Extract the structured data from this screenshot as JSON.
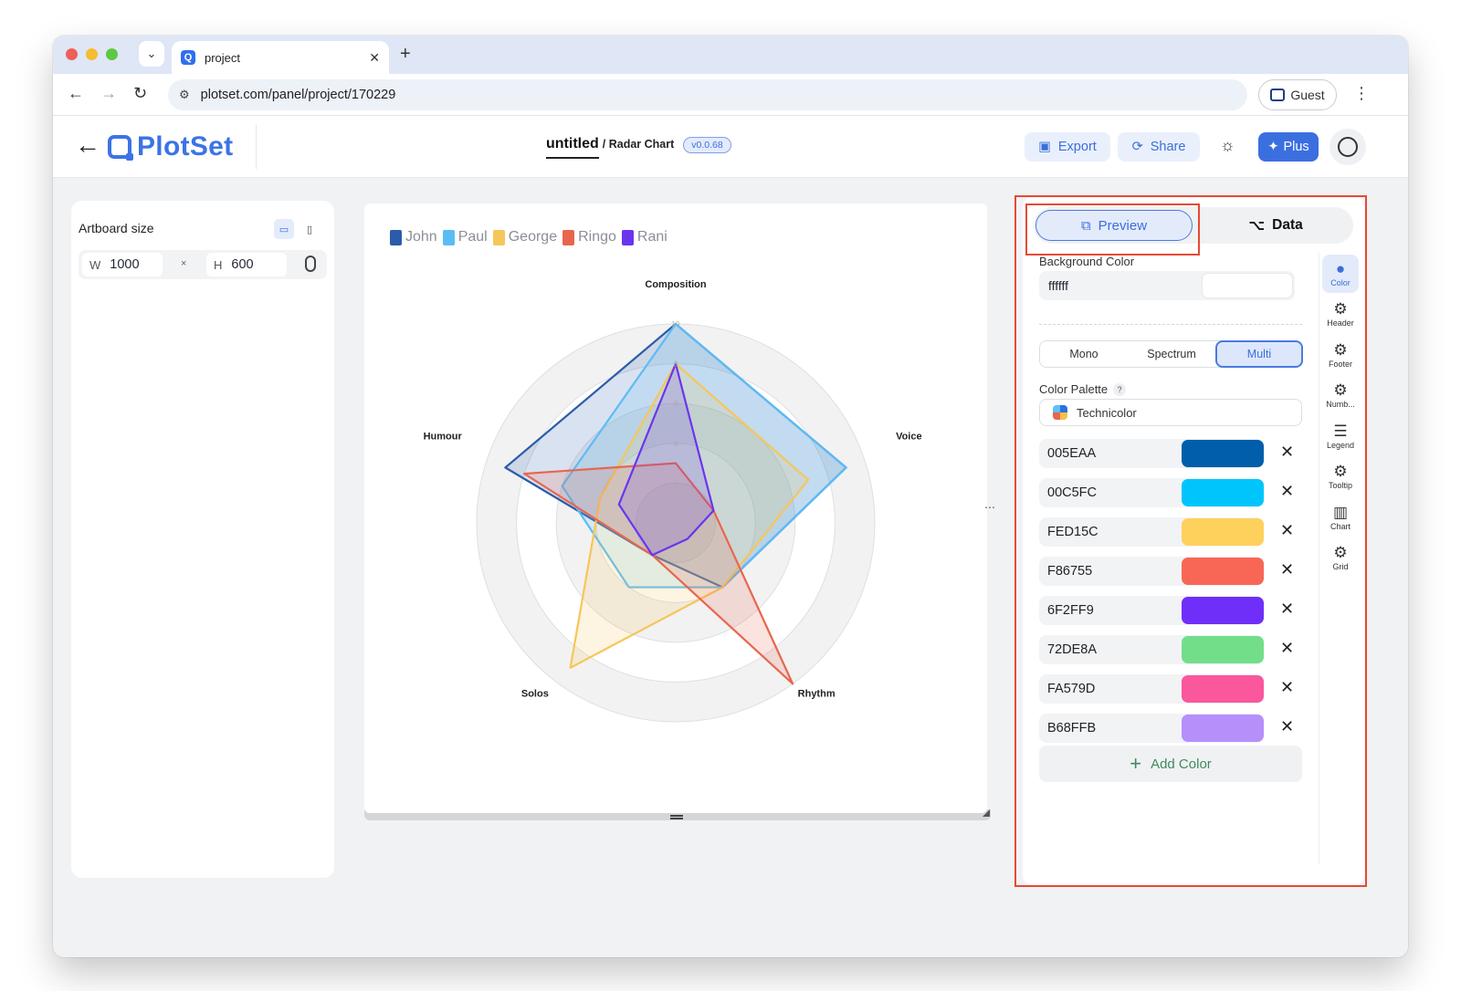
{
  "browser": {
    "tab_title": "project",
    "url": "plotset.com/panel/project/170229",
    "guest_label": "Guest"
  },
  "app": {
    "logo_text": "PlotSet",
    "doc_title": "untitled",
    "doc_type": "/ Radar Chart",
    "version": "v0.0.68",
    "export_label": "Export",
    "share_label": "Share",
    "plus_label": "Plus"
  },
  "artboard": {
    "label": "Artboard size",
    "width_prefix": "W",
    "width": "1000",
    "separator": "×",
    "height_prefix": "H",
    "height": "600"
  },
  "panel": {
    "tab_preview": "Preview",
    "tab_data": "Data",
    "background_label": "Background Color",
    "background_value": "ffffff",
    "modes": [
      "Mono",
      "Spectrum",
      "Multi"
    ],
    "active_mode": "Multi",
    "palette_label": "Color Palette",
    "palette_help": "?",
    "palette_name": "Technicolor",
    "colors": [
      "005EAA",
      "00C5FC",
      "FED15C",
      "F86755",
      "6F2FF9",
      "72DE8A",
      "FA579D",
      "B68FFB"
    ],
    "add_color_label": "Add Color",
    "side_nav": [
      "Color",
      "Header",
      "Footer",
      "Numb...",
      "Legend",
      "Tooltip",
      "Chart",
      "Grid"
    ]
  },
  "chart_data": {
    "type": "radar",
    "axes": [
      "Composition",
      "Voice",
      "Rhythm",
      "Solos",
      "Humour"
    ],
    "rmax": 10,
    "ticks": [
      "2",
      "4",
      "6",
      "8",
      "10"
    ],
    "series": [
      {
        "name": "John",
        "color": "#2a5caa",
        "values": [
          10,
          9,
          4,
          2,
          9
        ]
      },
      {
        "name": "Paul",
        "color": "#5bbcf5",
        "values": [
          10,
          9,
          4,
          4,
          6
        ]
      },
      {
        "name": "George",
        "color": "#f6c65b",
        "values": [
          8,
          7,
          4,
          9,
          4
        ]
      },
      {
        "name": "Ringo",
        "color": "#e8664f",
        "values": [
          3,
          2,
          10,
          2,
          8
        ]
      },
      {
        "name": "Rani",
        "color": "#6a35ee",
        "values": [
          8,
          2,
          1,
          2,
          3
        ]
      }
    ]
  }
}
